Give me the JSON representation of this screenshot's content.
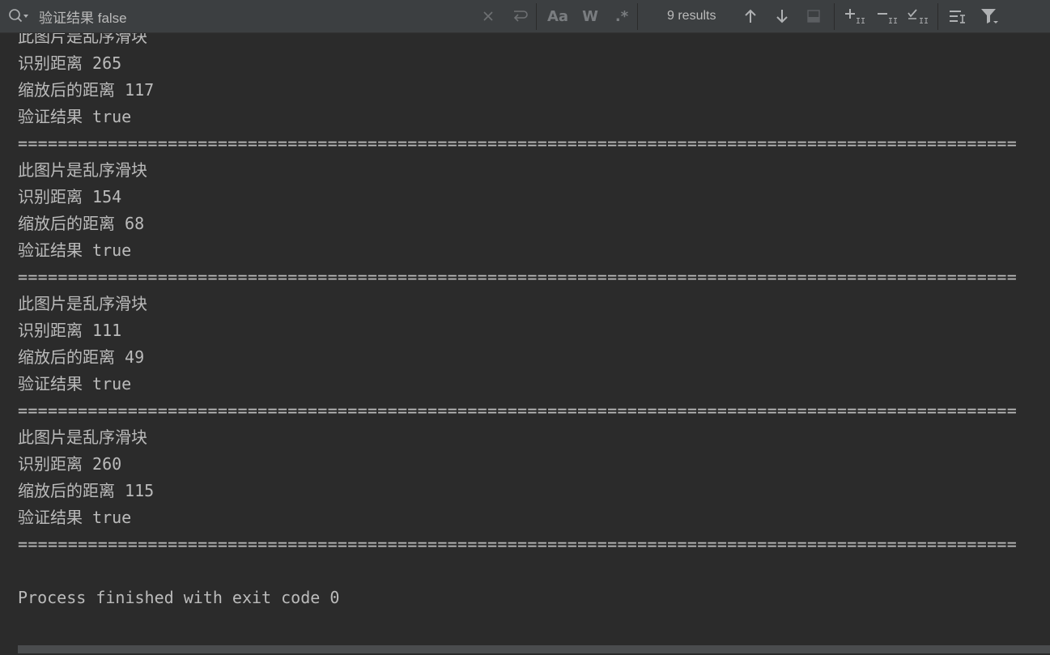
{
  "search": {
    "query": "验证结果 false",
    "results_count": "9 results",
    "match_case_label": "Aa",
    "whole_words_label": "W",
    "regex_label": ".*"
  },
  "console": {
    "lines": [
      "此图片是乱序滑块",
      "识别距离 265",
      "缩放后的距离 117",
      "验证结果 true",
      "====================================================================================================",
      "此图片是乱序滑块",
      "识别距离 154",
      "缩放后的距离 68",
      "验证结果 true",
      "====================================================================================================",
      "此图片是乱序滑块",
      "识别距离 111",
      "缩放后的距离 49",
      "验证结果 true",
      "====================================================================================================",
      "此图片是乱序滑块",
      "识别距离 260",
      "缩放后的距离 115",
      "验证结果 true",
      "====================================================================================================",
      "",
      "Process finished with exit code 0"
    ]
  },
  "colors": {
    "background": "#2b2b2b",
    "toolbar": "#3c3f41",
    "text": "#bbbbbb",
    "icon": "#afb1b3"
  }
}
